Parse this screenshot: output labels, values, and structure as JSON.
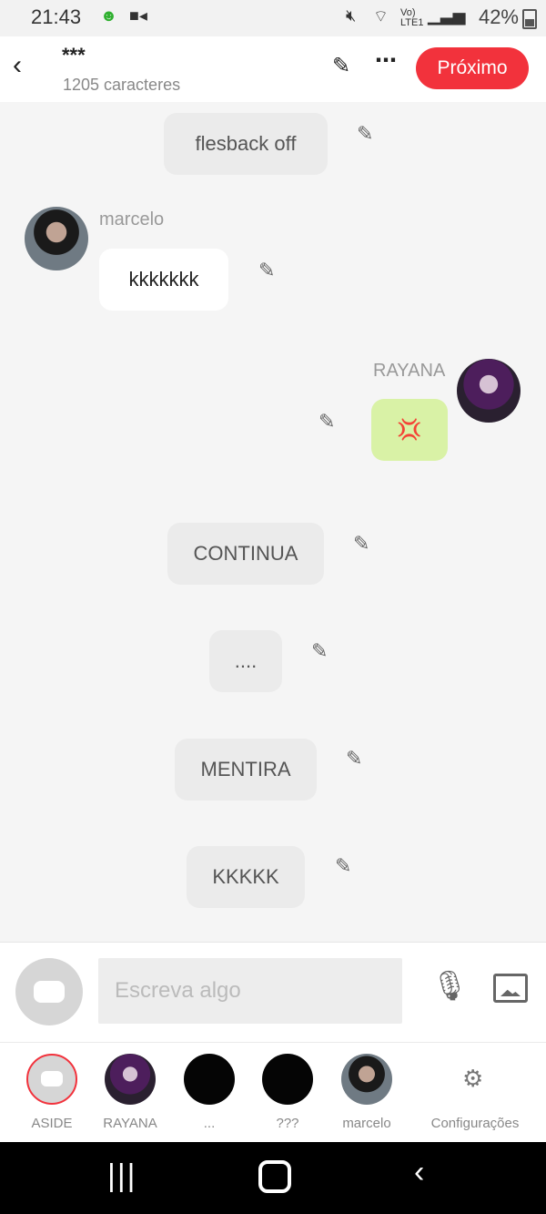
{
  "status_bar": {
    "time": "21:43",
    "battery": "42%",
    "icons": [
      "android-face-icon",
      "video-call-icon",
      "mute-icon",
      "wifi-icon",
      "volte-icon",
      "signal-icon",
      "battery-icon"
    ]
  },
  "header": {
    "title": "***",
    "subtitle": "1205 caracteres",
    "next_label": "Próximo"
  },
  "messages": [
    {
      "type": "center",
      "text": "flesback off"
    },
    {
      "type": "left",
      "sender": "marcelo",
      "text": "kkkkkkk"
    },
    {
      "type": "right",
      "sender": "RAYANA",
      "text": "💢"
    },
    {
      "type": "center",
      "text": "CONTINUA"
    },
    {
      "type": "center",
      "text": "...."
    },
    {
      "type": "center",
      "text": "MENTIRA"
    },
    {
      "type": "center",
      "text": "KKKKK"
    }
  ],
  "composer": {
    "placeholder": "Escreva algo"
  },
  "tabs": [
    {
      "label": "ASIDE"
    },
    {
      "label": "RAYANA"
    },
    {
      "label": "..."
    },
    {
      "label": "???"
    },
    {
      "label": "marcelo"
    },
    {
      "label": "Configurações"
    }
  ],
  "colors": {
    "accent": "#f2323c",
    "bubble_gray": "#ebebeb",
    "bubble_green": "#d9f2a6"
  }
}
